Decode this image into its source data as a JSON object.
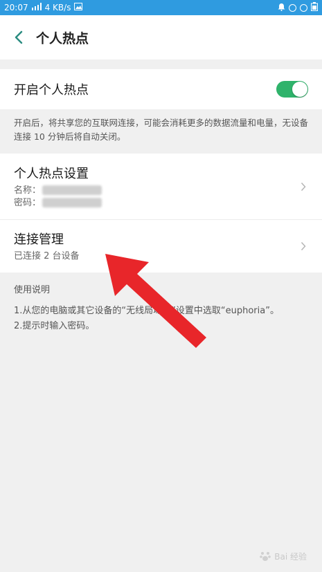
{
  "status_bar": {
    "time": "20:07",
    "network": "4 KB/s",
    "bg_color": "#2f9be0"
  },
  "app_bar": {
    "back_icon": "chevron-left-icon",
    "title": "个人热点"
  },
  "hotspot_toggle": {
    "label": "开启个人热点",
    "state": "on",
    "color": "#2fb36b"
  },
  "description": "开启后，将共享您的互联网连接，可能会消耗更多的数据流量和电量，无设备连接 10 分钟后将自动关闭。",
  "settings_row": {
    "title": "个人热点设置",
    "name_label": "名称：",
    "password_label": "密码："
  },
  "manage_row": {
    "title": "连接管理",
    "subtitle": "已连接 2 台设备"
  },
  "usage": {
    "title": "使用说明",
    "line1": "1.从您的电脑或其它设备的“无线局域网”设置中选取“euphoria”。",
    "line2": "2.提示时输入密码。"
  },
  "annotation": {
    "arrow_color": "#e8262a"
  },
  "watermark": {
    "text": "Bai 经验"
  }
}
